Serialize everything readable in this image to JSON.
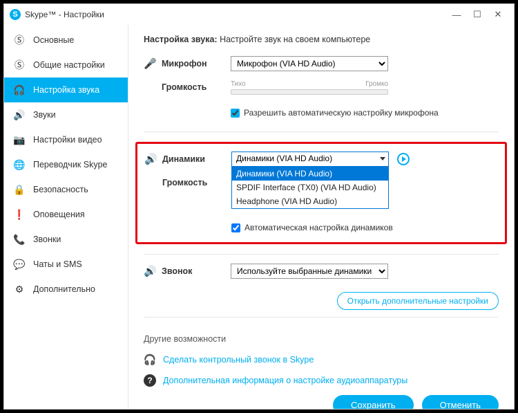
{
  "window": {
    "title": "Skype™ - Настройки"
  },
  "sidebar": {
    "items": [
      {
        "label": "Основные"
      },
      {
        "label": "Общие настройки"
      },
      {
        "label": "Настройка звука"
      },
      {
        "label": "Звуки"
      },
      {
        "label": "Настройки видео"
      },
      {
        "label": "Переводчик Skype"
      },
      {
        "label": "Безопасность"
      },
      {
        "label": "Оповещения"
      },
      {
        "label": "Звонки"
      },
      {
        "label": "Чаты и SMS"
      },
      {
        "label": "Дополнительно"
      }
    ]
  },
  "content": {
    "heading_bold": "Настройка звука:",
    "heading_rest": " Настройте звук на своем компьютере",
    "mic": {
      "label": "Микрофон",
      "value": "Микрофон (VIA HD Audio)",
      "volume_label": "Громкость",
      "slider_low": "Тихо",
      "slider_high": "Громко",
      "auto_checkbox": "Разрешить автоматическую настройку микрофона"
    },
    "speakers": {
      "label": "Динамики",
      "selected": "Динамики (VIA HD Audio)",
      "options": [
        "Динамики (VIA HD Audio)",
        "SPDIF Interface (TX0) (VIA HD Audio)",
        "Headphone (VIA HD Audio)"
      ],
      "volume_label": "Громкость",
      "auto_checkbox": "Автоматическая настройка динамиков"
    },
    "ring": {
      "label": "Звонок",
      "value": "Используйте выбранные динамики"
    },
    "extra_link": "Открыть дополнительные настройки",
    "other_title": "Другие возможности",
    "link_test_call": "Сделать контрольный звонок в Skype",
    "link_more_info": "Дополнительная информация о настройке аудиоаппаратуры"
  },
  "footer": {
    "save": "Сохранить",
    "cancel": "Отменить"
  }
}
